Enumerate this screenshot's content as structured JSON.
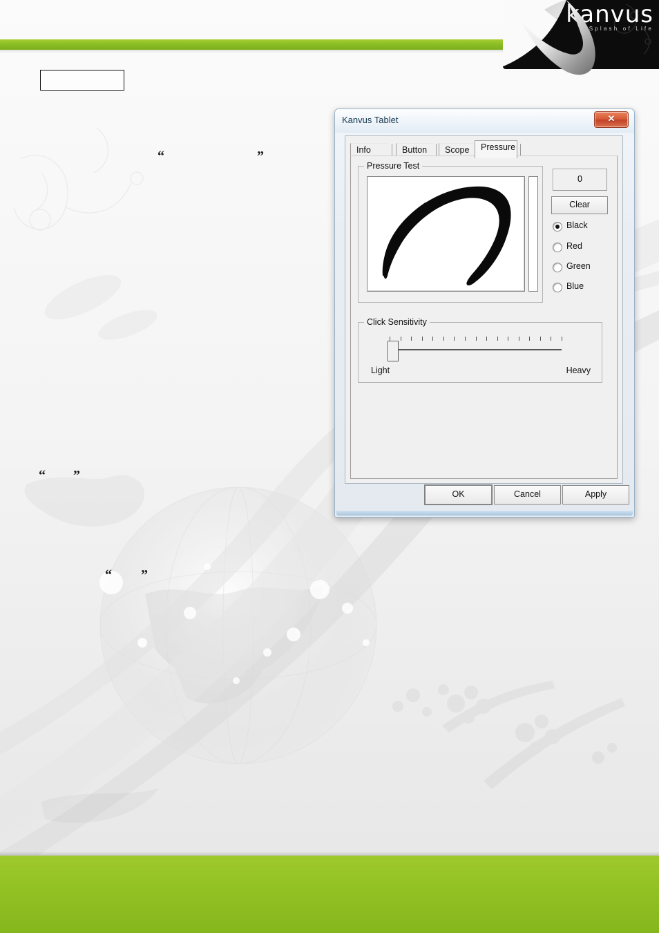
{
  "page": {
    "brand": {
      "word": "kanvus",
      "tagline": "A Splash of Life"
    },
    "title_box_text": "",
    "quote_marks": {
      "open": "“",
      "close": "”"
    }
  },
  "dialog": {
    "title": "Kanvus Tablet",
    "close_label": "✕",
    "tabs": [
      {
        "label": "Info",
        "active": false
      },
      {
        "label": "Button",
        "active": false
      },
      {
        "label": "Scope",
        "active": false
      },
      {
        "label": "Pressure",
        "active": true
      }
    ],
    "pressure_test": {
      "group_label": "Pressure Test",
      "pressure_value": "0",
      "clear_label": "Clear",
      "colors": [
        {
          "label": "Black",
          "hex": "#000000",
          "selected": true
        },
        {
          "label": "Red",
          "hex": "#ff0000",
          "selected": false
        },
        {
          "label": "Green",
          "hex": "#008000",
          "selected": false
        },
        {
          "label": "Blue",
          "hex": "#0000ff",
          "selected": false
        }
      ]
    },
    "click_sensitivity": {
      "group_label": "Click Sensitivity",
      "min_label": "Light",
      "max_label": "Heavy",
      "tick_count": 17,
      "value_percent": 0
    },
    "buttons": {
      "ok": "OK",
      "cancel": "Cancel",
      "apply": "Apply"
    }
  },
  "colors": {
    "green_bar": "#8cbf26",
    "green_footer": "#8fbf22",
    "banner_black": "#0c0c0c",
    "title_bar": "#eef4fa",
    "close_button": "#d9603b"
  }
}
